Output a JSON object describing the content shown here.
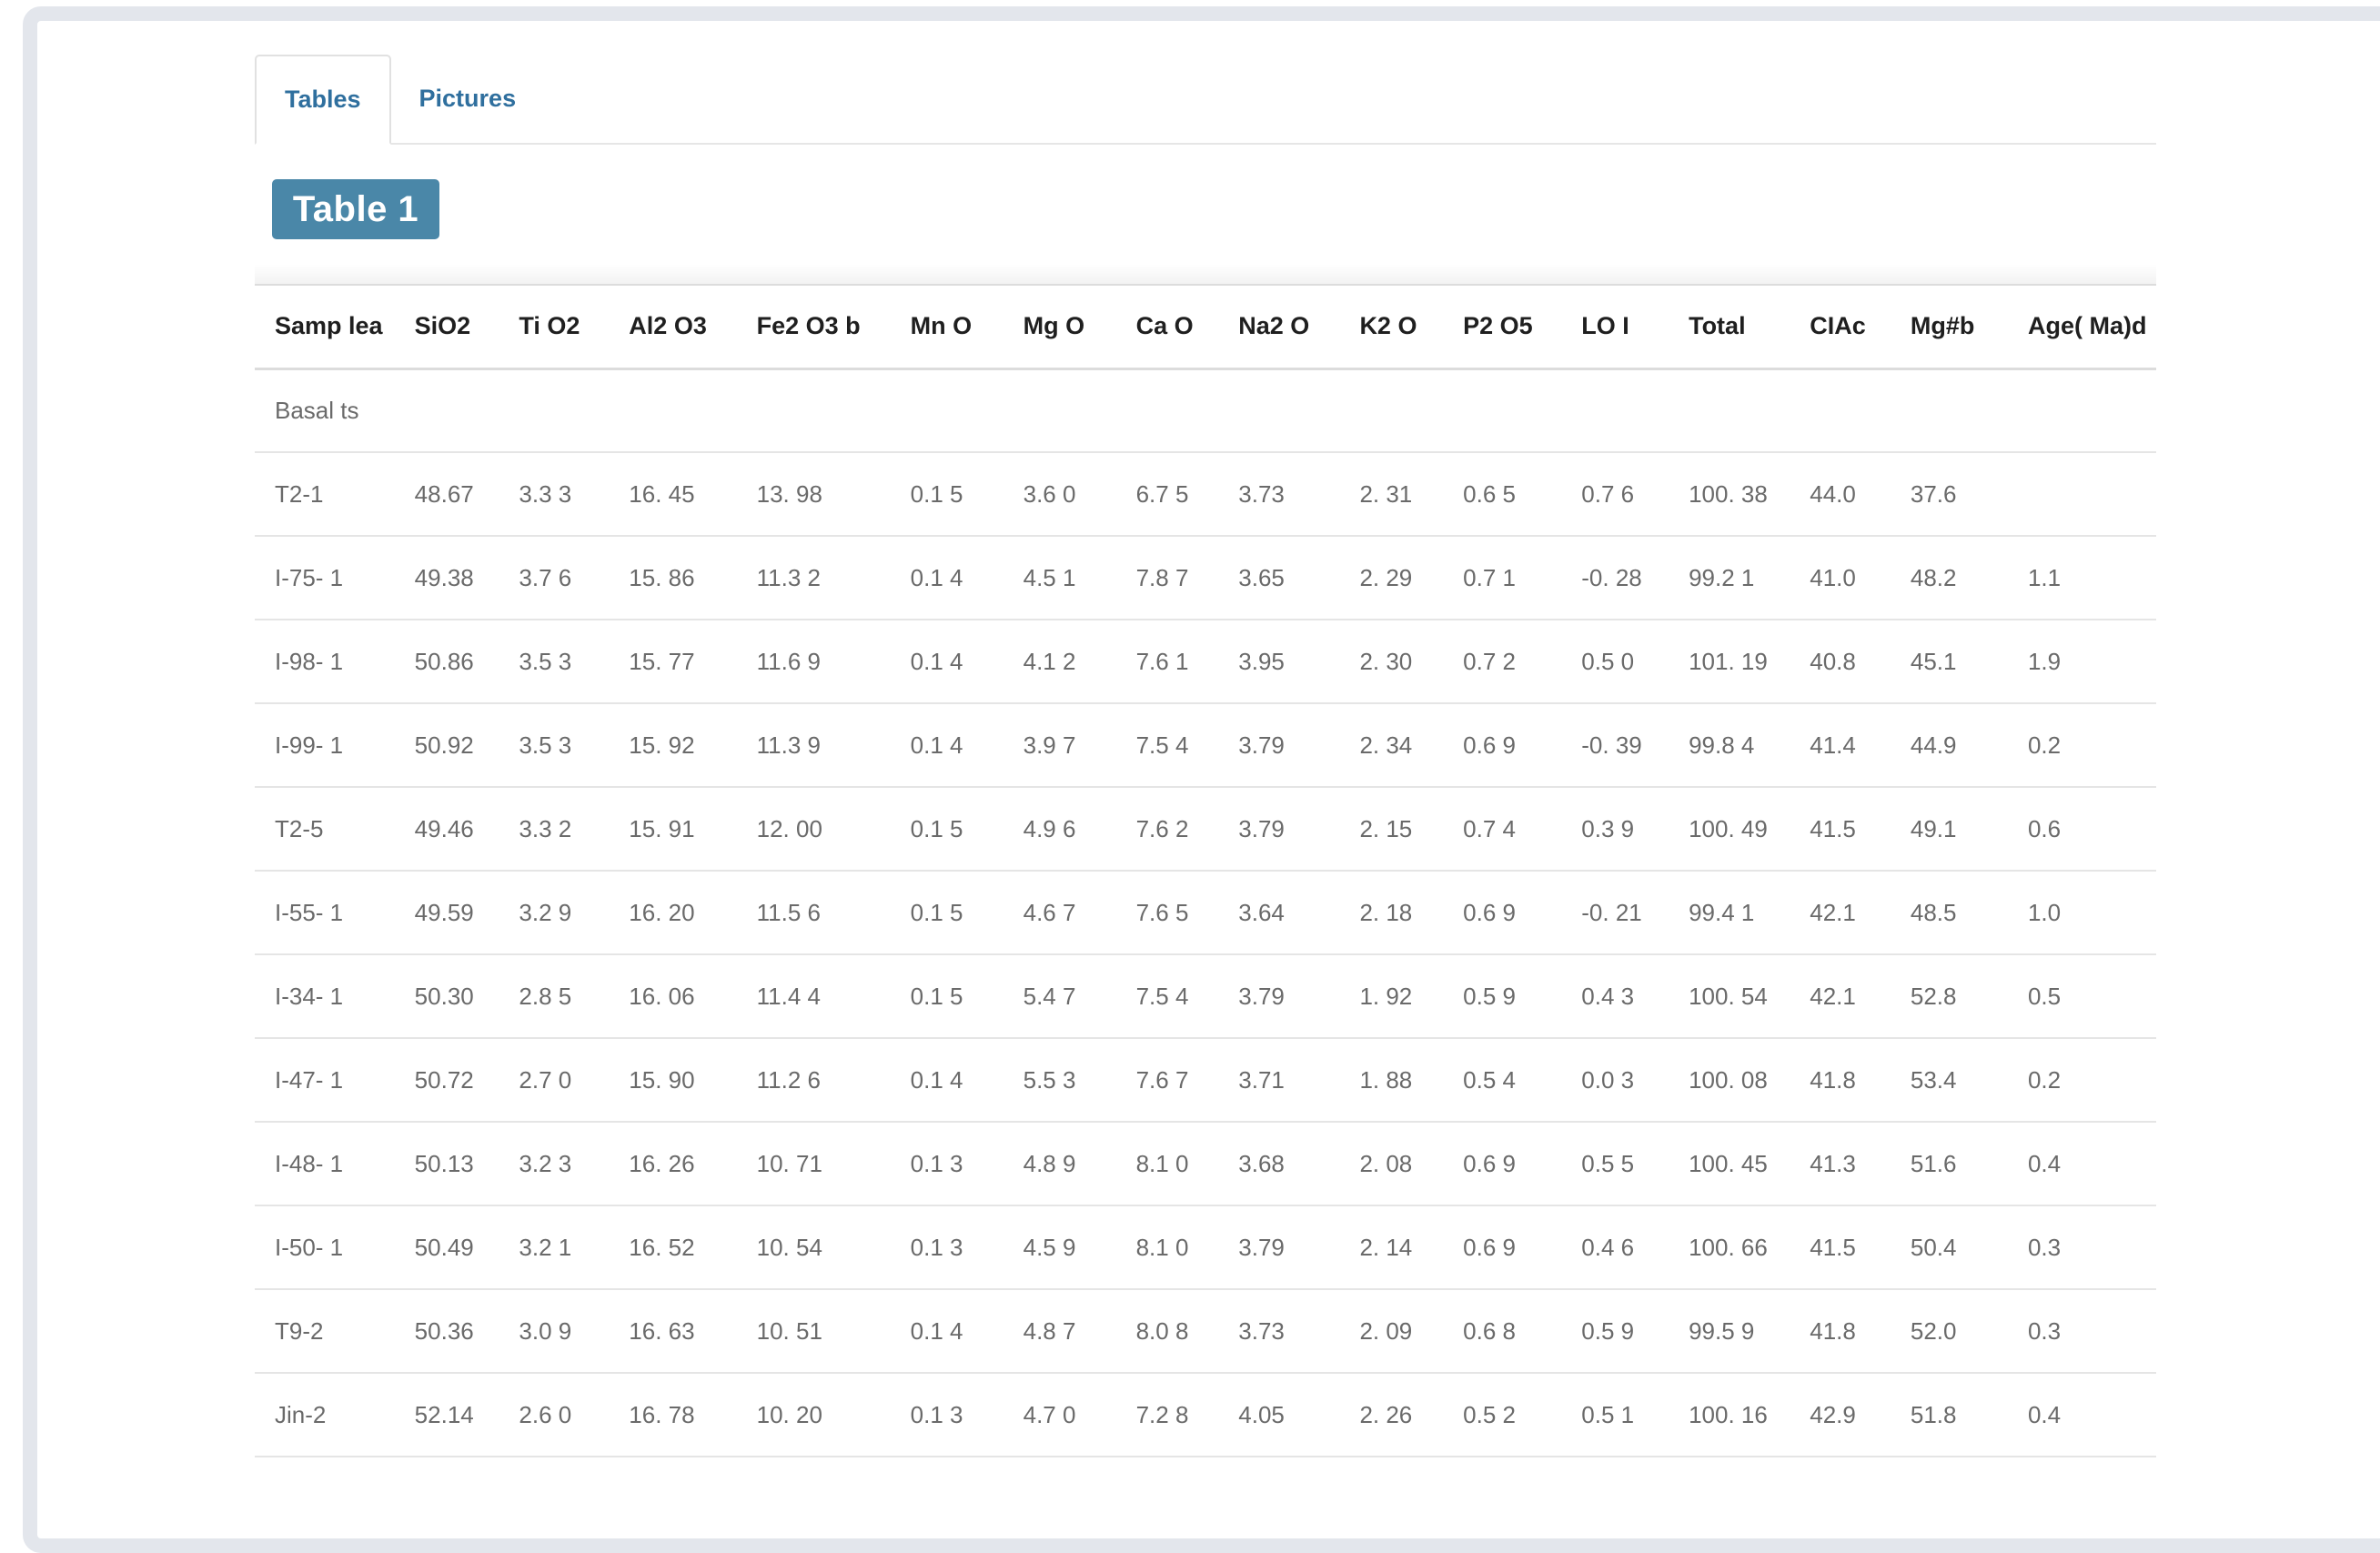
{
  "tabs": [
    {
      "label": "Tables",
      "active": true
    },
    {
      "label": "Pictures",
      "active": false
    }
  ],
  "badge": "Table 1",
  "columns": [
    "Samp lea",
    "SiO2",
    "Ti O2",
    "Al2 O3",
    "Fe2 O3 b",
    "Mn O",
    "Mg O",
    "Ca O",
    "Na2 O",
    "K2 O",
    "P2 O5",
    "LO I",
    "Total",
    "CIAc",
    "Mg#b",
    "Age( Ma)d"
  ],
  "group_label": "Basal ts",
  "rows": [
    [
      "T2-1",
      "48.67",
      "3.3 3",
      "16. 45",
      "13. 98",
      "0.1 5",
      "3.6 0",
      "6.7 5",
      "3.73",
      "2. 31",
      "0.6 5",
      "0.7 6",
      "100. 38",
      "44.0",
      "37.6",
      ""
    ],
    [
      "I-75- 1",
      "49.38",
      "3.7 6",
      "15. 86",
      "11.3 2",
      "0.1 4",
      "4.5 1",
      "7.8 7",
      "3.65",
      "2. 29",
      "0.7 1",
      "-0. 28",
      "99.2 1",
      "41.0",
      "48.2",
      "1.1"
    ],
    [
      "I-98- 1",
      "50.86",
      "3.5 3",
      "15. 77",
      "11.6 9",
      "0.1 4",
      "4.1 2",
      "7.6 1",
      "3.95",
      "2. 30",
      "0.7 2",
      "0.5 0",
      "101. 19",
      "40.8",
      "45.1",
      "1.9"
    ],
    [
      "I-99- 1",
      "50.92",
      "3.5 3",
      "15. 92",
      "11.3 9",
      "0.1 4",
      "3.9 7",
      "7.5 4",
      "3.79",
      "2. 34",
      "0.6 9",
      "-0. 39",
      "99.8 4",
      "41.4",
      "44.9",
      "0.2"
    ],
    [
      "T2-5",
      "49.46",
      "3.3 2",
      "15. 91",
      "12. 00",
      "0.1 5",
      "4.9 6",
      "7.6 2",
      "3.79",
      "2. 15",
      "0.7 4",
      "0.3 9",
      "100. 49",
      "41.5",
      "49.1",
      "0.6"
    ],
    [
      "I-55- 1",
      "49.59",
      "3.2 9",
      "16. 20",
      "11.5 6",
      "0.1 5",
      "4.6 7",
      "7.6 5",
      "3.64",
      "2. 18",
      "0.6 9",
      "-0. 21",
      "99.4 1",
      "42.1",
      "48.5",
      "1.0"
    ],
    [
      "I-34- 1",
      "50.30",
      "2.8 5",
      "16. 06",
      "11.4 4",
      "0.1 5",
      "5.4 7",
      "7.5 4",
      "3.79",
      "1. 92",
      "0.5 9",
      "0.4 3",
      "100. 54",
      "42.1",
      "52.8",
      "0.5"
    ],
    [
      "I-47- 1",
      "50.72",
      "2.7 0",
      "15. 90",
      "11.2 6",
      "0.1 4",
      "5.5 3",
      "7.6 7",
      "3.71",
      "1. 88",
      "0.5 4",
      "0.0 3",
      "100. 08",
      "41.8",
      "53.4",
      "0.2"
    ],
    [
      "I-48- 1",
      "50.13",
      "3.2 3",
      "16. 26",
      "10. 71",
      "0.1 3",
      "4.8 9",
      "8.1 0",
      "3.68",
      "2. 08",
      "0.6 9",
      "0.5 5",
      "100. 45",
      "41.3",
      "51.6",
      "0.4"
    ],
    [
      "I-50- 1",
      "50.49",
      "3.2 1",
      "16. 52",
      "10. 54",
      "0.1 3",
      "4.5 9",
      "8.1 0",
      "3.79",
      "2. 14",
      "0.6 9",
      "0.4 6",
      "100. 66",
      "41.5",
      "50.4",
      "0.3"
    ],
    [
      "T9-2",
      "50.36",
      "3.0 9",
      "16. 63",
      "10. 51",
      "0.1 4",
      "4.8 7",
      "8.0 8",
      "3.73",
      "2. 09",
      "0.6 8",
      "0.5 9",
      "99.5 9",
      "41.8",
      "52.0",
      "0.3"
    ],
    [
      "Jin-2",
      "52.14",
      "2.6 0",
      "16. 78",
      "10. 20",
      "0.1 3",
      "4.7 0",
      "7.2 8",
      "4.05",
      "2. 26",
      "0.5 2",
      "0.5 1",
      "100. 16",
      "42.9",
      "51.8",
      "0.4"
    ]
  ]
}
